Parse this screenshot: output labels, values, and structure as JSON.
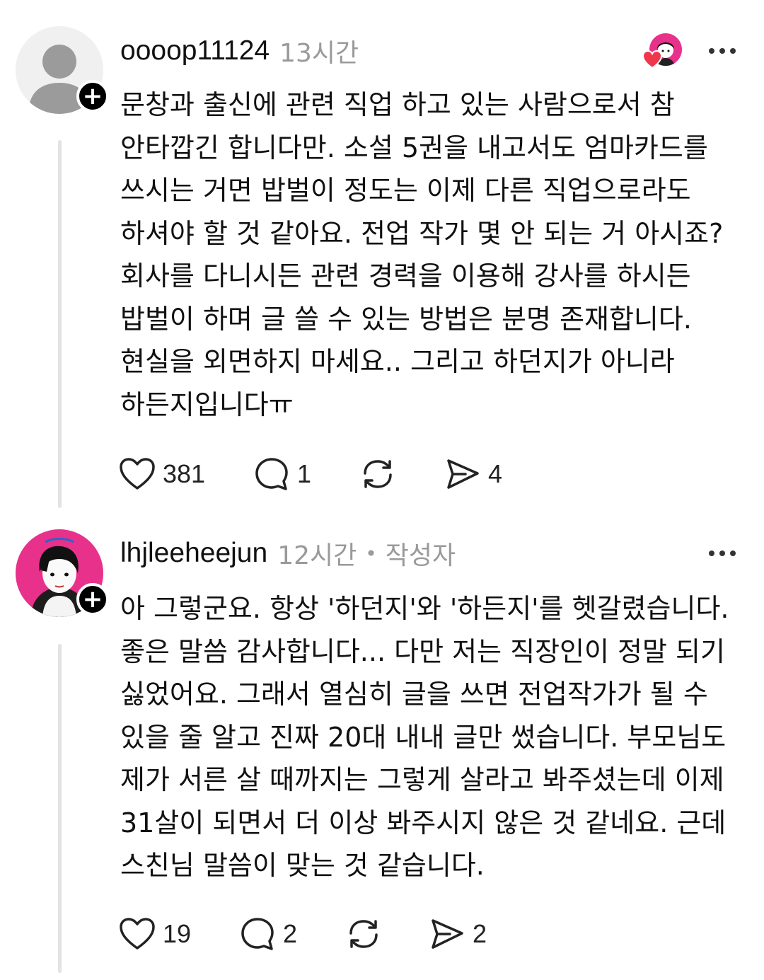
{
  "posts": [
    {
      "username": "oooop11124",
      "time": "13시간",
      "body_lines": [
        "문창과 출신에 관련 직업 하고 있는 사람으로서 참",
        "안타깝긴 합니다만. 소설 5권을 내고서도 엄마카드를",
        "쓰시는 거면 밥벌이 정도는 이제 다른 직업으로라도",
        "하셔야 할 것 같아요. 전업 작가 몇 안 되는 거 아시죠?",
        "회사를 다니시든 관련 경력을 이용해 강사를 하시든",
        "밥벌이 하며 글 쓸 수 있는 방법은 분명 존재합니다.",
        "현실을 외면하지 마세요.. 그리고 하던지가 아니라",
        "하든지입니다ㅠ"
      ],
      "likes": "381",
      "replies": "1",
      "reposts": "",
      "shares": "4"
    },
    {
      "username": "lhjleeheejun",
      "time": "12시간",
      "author_tag": "작성자",
      "body_lines": [
        "아 그렇군요. 항상 '하던지'와 '하든지'를 헷갈렸습니다.",
        "좋은 말씀 감사합니다... 다만 저는 직장인이 정말 되기",
        "싫었어요. 그래서 열심히 글을 쓰면 전업작가가 될 수",
        "있을 줄 알고 진짜 20대 내내 글만 썼습니다. 부모님도",
        "제가 서른 살 때까지는 그렇게 살라고 봐주셨는데 이제",
        "31살이 되면서 더 이상 봐주시지 않은 것 같네요. 근데",
        "스친님 말씀이 맞는 것 같습니다."
      ],
      "likes": "19",
      "replies": "2",
      "reposts": "",
      "shares": "2"
    }
  ],
  "icons": {
    "follow": "plus-icon",
    "more": "more-dots-icon",
    "like": "heart-icon",
    "reply": "comment-bubble-icon",
    "repost": "repost-icon",
    "share": "send-icon"
  },
  "colors": {
    "text": "#111111",
    "meta": "#9a9a9a",
    "accent_pink": "#e8318a",
    "heart_red": "#f0364b",
    "thread_line": "#e3e3e3"
  }
}
